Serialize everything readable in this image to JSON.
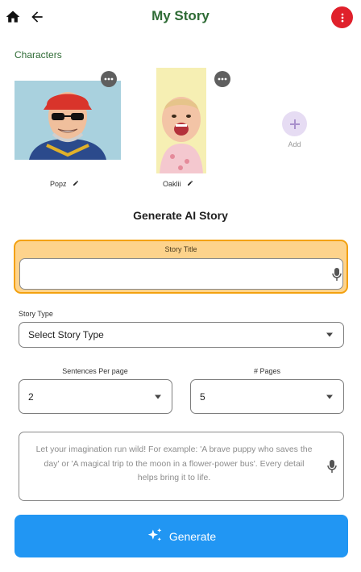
{
  "header": {
    "title": "My Story",
    "home_icon": "home-icon",
    "back_icon": "arrow-back-icon",
    "menu_icon": "more-vertical-icon",
    "menu_color": "#e0202b",
    "title_color": "#2e6b35"
  },
  "characters": {
    "section_label": "Characters",
    "items": [
      {
        "name": "Popz",
        "edit_icon": "pencil-icon",
        "more_icon": "more-horizontal-icon"
      },
      {
        "name": "Oaklii",
        "edit_icon": "pencil-icon",
        "more_icon": "more-horizontal-icon"
      }
    ],
    "add_label": "Add"
  },
  "generator": {
    "heading": "Generate AI Story",
    "story_title": {
      "label": "Story Title",
      "value": "",
      "accent": "#f3a10f"
    },
    "story_type": {
      "label": "Story Type",
      "value": "Select Story Type"
    },
    "sentences_per_page": {
      "label": "Sentences Per page",
      "value": "2"
    },
    "pages": {
      "label": "# Pages",
      "value": "5"
    },
    "prompt": {
      "placeholder": "Let your imagination run wild! For example: 'A brave puppy who saves the day' or 'A magical trip to the moon in a flower-power bus'. Every detail helps bring it to life."
    },
    "generate_button": {
      "label": "Generate",
      "color": "#2196f3",
      "icon": "sparkles-icon"
    }
  }
}
